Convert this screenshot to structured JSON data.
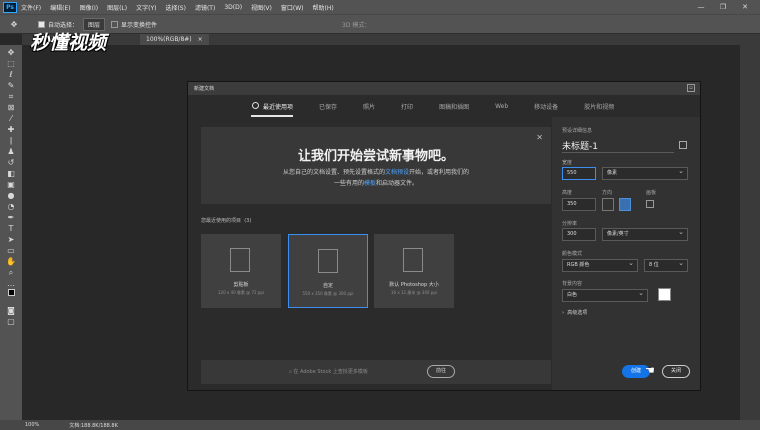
{
  "app": {
    "logo": "Ps",
    "menu": [
      "文件(F)",
      "编辑(E)",
      "图像(I)",
      "图层(L)",
      "文字(Y)",
      "选择(S)",
      "滤镜(T)",
      "3D(D)",
      "视图(V)",
      "窗口(W)",
      "帮助(H)"
    ]
  },
  "options": {
    "auto_select_label": "自动选择：",
    "auto_select_value": "图层",
    "show_transform": "显示变换控件",
    "mode_3d": "3D 模式："
  },
  "doc_tab": {
    "label": "100%(RGB/8#)",
    "close": "×"
  },
  "watermark": "秒懂视频",
  "status": {
    "zoom": "100%",
    "doc": "文档:188.8K/188.8K"
  },
  "dialog": {
    "title": "新建文档",
    "tabs": [
      "最近使用项",
      "已保存",
      "照片",
      "打印",
      "图稿和插图",
      "Web",
      "移动设备",
      "胶片和视频"
    ],
    "hero": {
      "headline": "让我们开始尝试新事物吧。",
      "line1_a": "从您自己的文档设置、预先设置格式的",
      "line1_link": "文档预设",
      "line1_b": "开始，或者利用我们的",
      "line2_a": "一些有用的",
      "line2_link": "模板",
      "line2_b": "和启动器文件。"
    },
    "recent_label": "您最近使用的项目",
    "recent_count": "(3)",
    "cards": [
      {
        "name": "剪贴板",
        "detail": "120 x 40 像素 @ 72 ppi"
      },
      {
        "name": "自定",
        "detail": "550 x 350 像素 @ 300 ppi"
      },
      {
        "name": "默认 Photoshop 大小",
        "detail": "16 x 12 厘米 @ 300 ppi"
      }
    ],
    "search_placeholder": "在 Adobe Stock 上查找更多模板",
    "search_button": "前往",
    "details": {
      "section_label": "预设详细信息",
      "doc_title": "未标题-1",
      "width_label": "宽度",
      "width_value": "550",
      "width_unit": "像素",
      "height_label": "高度",
      "height_value": "350",
      "orientation_label": "方向",
      "artboard_label": "画板",
      "resolution_label": "分辨率",
      "resolution_value": "300",
      "resolution_unit": "像素/英寸",
      "color_mode_label": "颜色模式",
      "color_mode_value": "RGB 颜色",
      "bit_depth": "8 位",
      "background_label": "背景内容",
      "background_value": "白色",
      "background_color": "#ffffff",
      "advanced": "高级选项"
    },
    "create_button": "创建",
    "close_button": "关闭"
  }
}
